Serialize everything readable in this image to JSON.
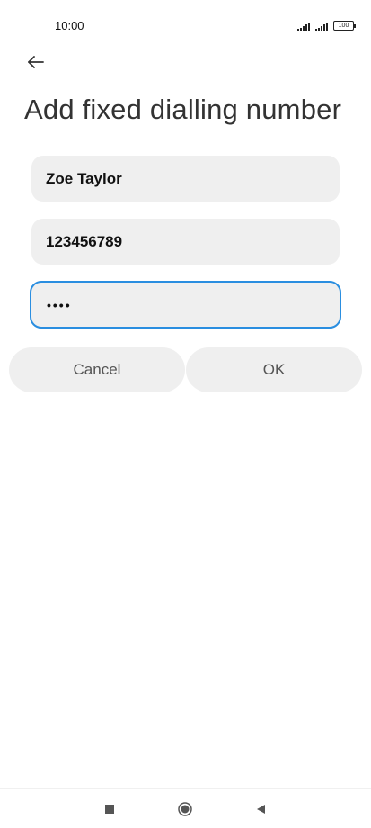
{
  "status_bar": {
    "time": "10:00",
    "battery": "100",
    "icons": [
      "signal-icon",
      "signal-icon",
      "battery-icon"
    ]
  },
  "header": {
    "back_icon": "arrow-left-icon",
    "title": "Add fixed dialling number"
  },
  "form": {
    "name_value": "Zoe Taylor",
    "number_value": "123456789",
    "pin_masked": "••••"
  },
  "actions": {
    "cancel_label": "Cancel",
    "ok_label": "OK"
  },
  "nav_bar": {
    "icons": [
      "recents-icon",
      "home-icon",
      "back-icon"
    ]
  },
  "colors": {
    "focus_border": "#2a8ee0",
    "field_background": "#efefef"
  }
}
